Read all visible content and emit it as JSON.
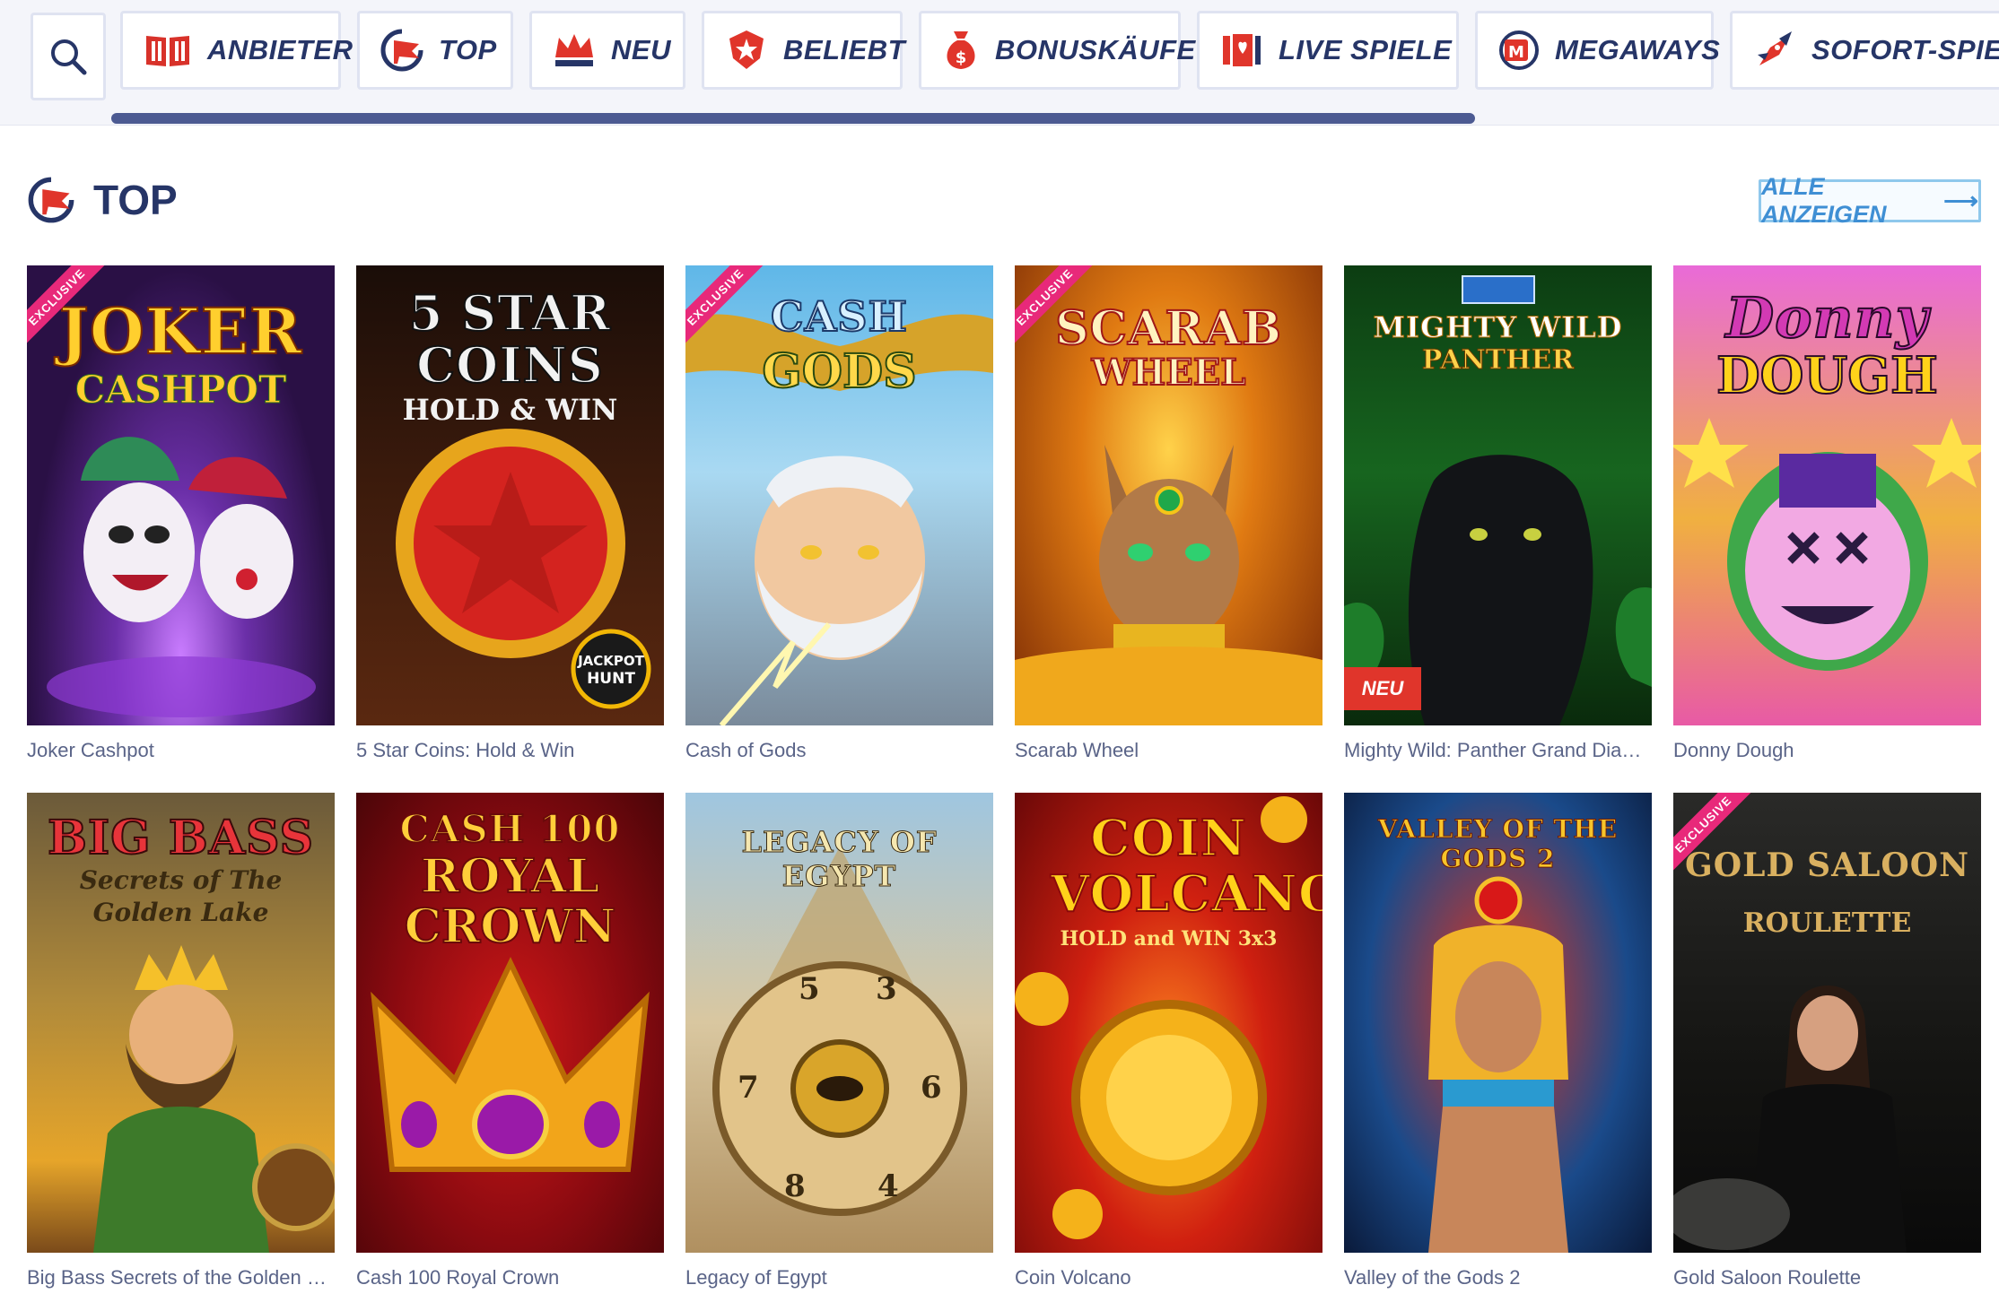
{
  "nav": {
    "search_icon": "search-icon",
    "items": [
      {
        "label": "ANBIETER",
        "icon": "book-icon"
      },
      {
        "label": "TOP",
        "icon": "flag-circle-icon"
      },
      {
        "label": "NEU",
        "icon": "crown-icon"
      },
      {
        "label": "BELIEBT",
        "icon": "star-badge-icon"
      },
      {
        "label": "BONUSKÄUFE",
        "icon": "money-bag-icon"
      },
      {
        "label": "LIVE SPIELE",
        "icon": "cards-icon"
      },
      {
        "label": "MEGAWAYS",
        "icon": "megaways-icon"
      },
      {
        "label": "SOFORT-SPIELE",
        "icon": "rocket-icon"
      }
    ]
  },
  "section": {
    "title": "TOP",
    "icon": "flag-circle-icon",
    "show_all": "ALLE ANZEIGEN",
    "show_all_arrow": "⟶"
  },
  "games": [
    {
      "name": "Joker Cashpot",
      "art_title": "JOKER",
      "art_sub": "CASHPOT",
      "exclusive": "EXCLUSIVE",
      "badge": ""
    },
    {
      "name": "5 Star Coins: Hold & Win",
      "art_title": "5 STAR COINS",
      "art_sub": "HOLD & WIN",
      "exclusive": "",
      "badge": ""
    },
    {
      "name": "Cash of Gods",
      "art_title": "CASH",
      "art_sub": "GODS",
      "exclusive": "EXCLUSIVE",
      "badge": ""
    },
    {
      "name": "Scarab Wheel",
      "art_title": "SCARAB",
      "art_sub": "WHEEL",
      "exclusive": "EXCLUSIVE",
      "badge": ""
    },
    {
      "name": "Mighty Wild: Panther Grand Diamond Edition",
      "art_title": "MIGHTY WILD",
      "art_sub": "PANTHER",
      "exclusive": "",
      "badge": "NEU"
    },
    {
      "name": "Donny Dough",
      "art_title": "Donny",
      "art_sub": "DOUGH",
      "exclusive": "",
      "badge": ""
    },
    {
      "name": "Big Bass Secrets of the Golden Lake",
      "art_title": "BIG BASS",
      "art_sub": "Secrets of The Golden Lake",
      "exclusive": "",
      "badge": ""
    },
    {
      "name": "Cash 100 Royal Crown",
      "art_title": "CASH 100",
      "art_sub": "ROYAL CROWN",
      "exclusive": "",
      "badge": ""
    },
    {
      "name": "Legacy of Egypt",
      "art_title": "LEGACY OF EGYPT",
      "art_sub": "",
      "exclusive": "",
      "badge": ""
    },
    {
      "name": "Coin Volcano",
      "art_title": "COIN VOLCANO",
      "art_sub": "HOLD and WIN 3x3",
      "exclusive": "",
      "badge": ""
    },
    {
      "name": "Valley of the Gods 2",
      "art_title": "VALLEY OF THE GODS 2",
      "art_sub": "",
      "exclusive": "",
      "badge": ""
    },
    {
      "name": "Gold Saloon Roulette",
      "art_title": "GOLD SALOON",
      "art_sub": "ROULETTE",
      "exclusive": "EXCLUSIVE",
      "badge": ""
    }
  ],
  "colors": {
    "navy": "#263567",
    "accent_blue": "#3f8fd4",
    "red": "#e0352b",
    "pink": "#e8297a"
  }
}
